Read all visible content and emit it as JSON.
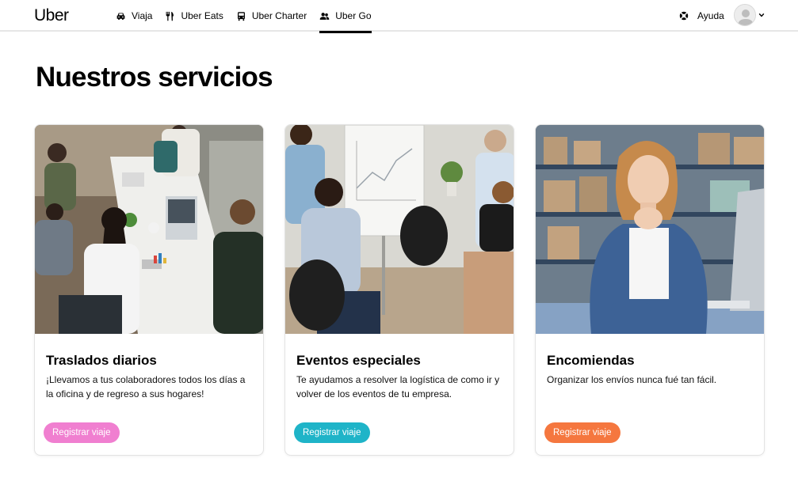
{
  "brand": {
    "logo": "Uber"
  },
  "nav": {
    "items": [
      {
        "label": "Viaja",
        "icon": "car-icon"
      },
      {
        "label": "Uber Eats",
        "icon": "fork-knife-icon"
      },
      {
        "label": "Uber Charter",
        "icon": "bus-icon"
      },
      {
        "label": "Uber Go",
        "icon": "group-icon",
        "active": true
      }
    ],
    "help_label": "Ayuda",
    "help_icon": "lifebuoy-icon"
  },
  "page": {
    "title": "Nuestros servicios"
  },
  "cards": [
    {
      "title": "Traslados diarios",
      "description": "¡Llevamos a tus colaboradores todos los días a la oficina y de regreso a sus hogares!",
      "button": "Registrar viaje",
      "button_color": "#f07fd0",
      "image": "office-meeting-photo"
    },
    {
      "title": "Eventos especiales",
      "description": "Te ayudamos a resolver la logística de como ir y volver de los eventos de tu empresa.",
      "button": "Registrar viaje",
      "button_color": "#1fb4c8",
      "image": "presentation-event-photo"
    },
    {
      "title": "Encomiendas",
      "description": "Organizar los envíos nunca fué tan fácil.",
      "button": "Registrar viaje",
      "button_color": "#f5773f",
      "image": "warehouse-woman-photo"
    }
  ]
}
